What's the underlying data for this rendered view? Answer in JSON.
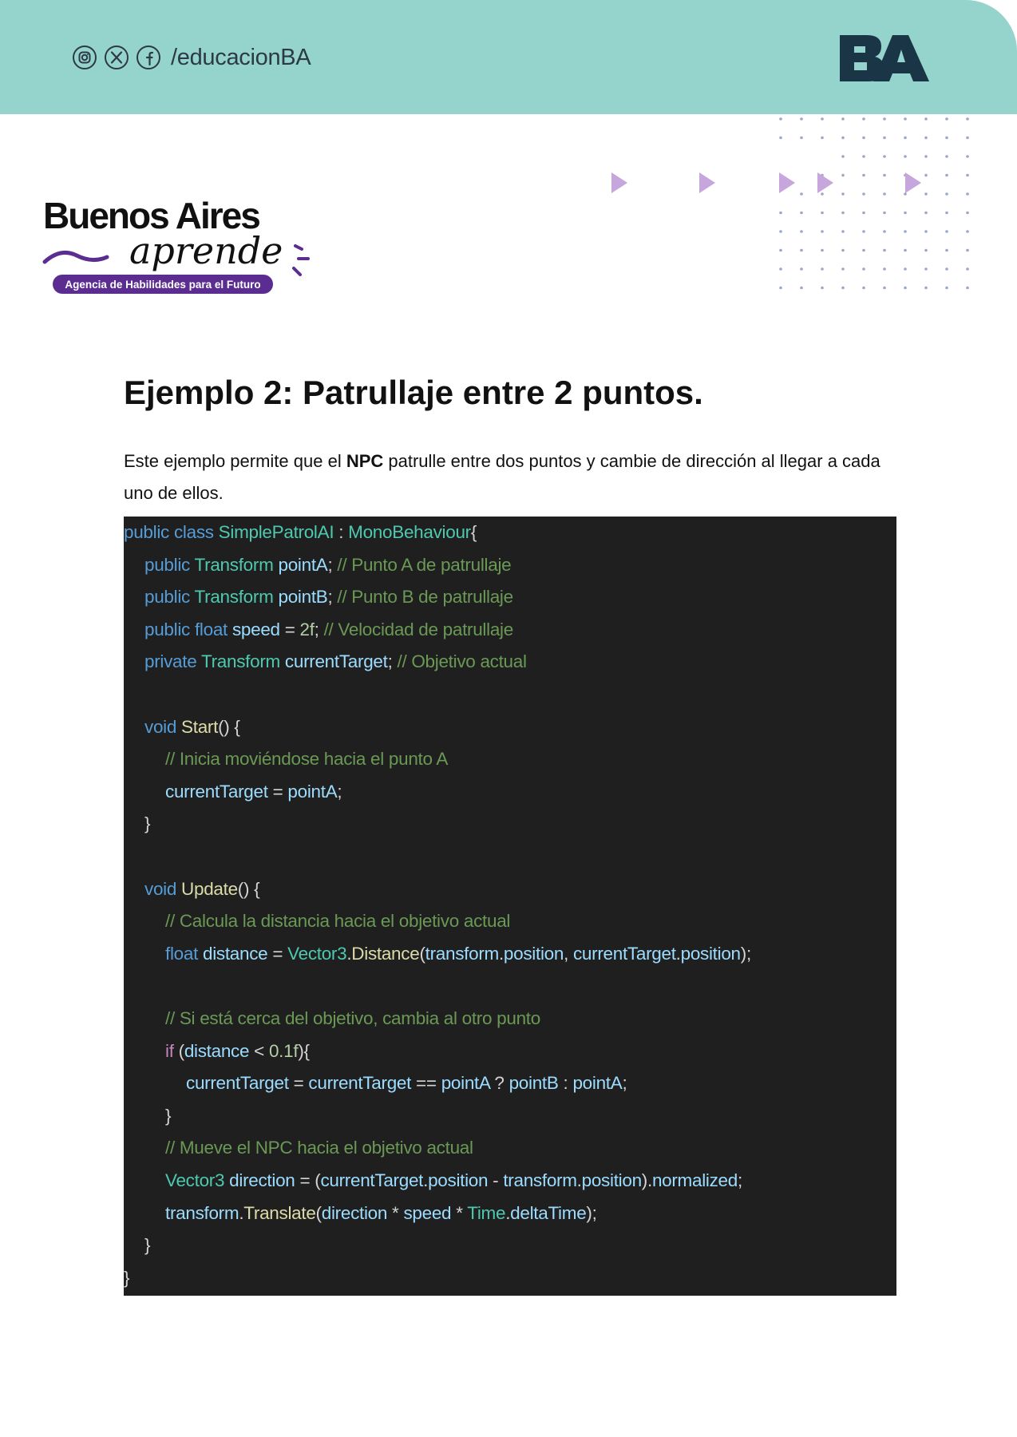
{
  "header": {
    "social_handle": "/educacionBA",
    "icons": [
      "instagram-icon",
      "x-icon",
      "facebook-icon"
    ],
    "logo_text": "BA",
    "band_color": "#95d3cd"
  },
  "brand": {
    "line1": "Buenos Aires",
    "line2": "aprende",
    "tagline": "Agencia de Habilidades para el Futuro",
    "accent_color": "#5b2d91"
  },
  "doc": {
    "title": "Ejemplo 2: Patrullaje entre 2 puntos.",
    "intro_before": "Este ejemplo permite que el ",
    "intro_bold": "NPC",
    "intro_after": " patrulle entre dos puntos y cambie de dirección al llegar a cada uno de ellos."
  },
  "code": {
    "lines": [
      {
        "indent": 0,
        "tokens": [
          [
            "kw",
            "public "
          ],
          [
            "kw",
            "class "
          ],
          [
            "ty",
            "SimplePatrolAI"
          ],
          [
            "pl",
            " : "
          ],
          [
            "ty",
            "MonoBehaviour"
          ],
          [
            "pl",
            "{"
          ]
        ]
      },
      {
        "indent": 1,
        "tokens": [
          [
            "kw",
            "public "
          ],
          [
            "ty",
            "Transform "
          ],
          [
            "id",
            "pointA"
          ],
          [
            "pl",
            "; "
          ],
          [
            "cm",
            "// Punto A de patrullaje"
          ]
        ]
      },
      {
        "indent": 1,
        "tokens": [
          [
            "kw",
            "public "
          ],
          [
            "ty",
            "Transform "
          ],
          [
            "id",
            "pointB"
          ],
          [
            "pl",
            "; "
          ],
          [
            "cm",
            "// Punto B de patrullaje"
          ]
        ]
      },
      {
        "indent": 1,
        "tokens": [
          [
            "kw",
            "public "
          ],
          [
            "kw",
            "float "
          ],
          [
            "id",
            "speed"
          ],
          [
            "pl",
            " = "
          ],
          [
            "num",
            "2f"
          ],
          [
            "pl",
            "; "
          ],
          [
            "cm",
            "// Velocidad de patrullaje"
          ]
        ]
      },
      {
        "indent": 1,
        "tokens": [
          [
            "kw",
            "private "
          ],
          [
            "ty",
            "Transform "
          ],
          [
            "id",
            "currentTarget"
          ],
          [
            "pl",
            "; "
          ],
          [
            "cm",
            "// Objetivo actual"
          ]
        ]
      },
      {
        "indent": 0,
        "tokens": []
      },
      {
        "indent": 1,
        "tokens": [
          [
            "kw",
            "void "
          ],
          [
            "fn",
            "Start"
          ],
          [
            "pl",
            "() {"
          ]
        ]
      },
      {
        "indent": 2,
        "tokens": [
          [
            "cm",
            "// Inicia moviéndose hacia el punto A"
          ]
        ]
      },
      {
        "indent": 2,
        "tokens": [
          [
            "id",
            "currentTarget"
          ],
          [
            "pl",
            " = "
          ],
          [
            "id",
            "pointA"
          ],
          [
            "pl",
            ";"
          ]
        ]
      },
      {
        "indent": 1,
        "tokens": [
          [
            "pl",
            "}"
          ]
        ]
      },
      {
        "indent": 0,
        "tokens": []
      },
      {
        "indent": 1,
        "tokens": [
          [
            "kw",
            "void "
          ],
          [
            "fn",
            "Update"
          ],
          [
            "pl",
            "() {"
          ]
        ]
      },
      {
        "indent": 2,
        "tokens": [
          [
            "cm",
            "// Calcula la distancia hacia el objetivo actual"
          ]
        ]
      },
      {
        "indent": 2,
        "tokens": [
          [
            "kw",
            "float "
          ],
          [
            "id",
            "distance"
          ],
          [
            "pl",
            " = "
          ],
          [
            "ty",
            "Vector3"
          ],
          [
            "pl",
            "."
          ],
          [
            "fn",
            "Distance"
          ],
          [
            "pl",
            "("
          ],
          [
            "id",
            "transform"
          ],
          [
            "pl",
            "."
          ],
          [
            "id",
            "position"
          ],
          [
            "pl",
            ", "
          ],
          [
            "id",
            "currentTarget"
          ],
          [
            "pl",
            "."
          ],
          [
            "id",
            "position"
          ],
          [
            "pl",
            ");"
          ]
        ]
      },
      {
        "indent": 0,
        "tokens": []
      },
      {
        "indent": 2,
        "tokens": [
          [
            "cm",
            "// Si está cerca del objetivo, cambia al otro punto"
          ]
        ]
      },
      {
        "indent": 2,
        "tokens": [
          [
            "ctl",
            "if "
          ],
          [
            "pl",
            "("
          ],
          [
            "id",
            "distance"
          ],
          [
            "pl",
            " < "
          ],
          [
            "num",
            "0.1f"
          ],
          [
            "pl",
            "){"
          ]
        ]
      },
      {
        "indent": 3,
        "tokens": [
          [
            "id",
            "currentTarget"
          ],
          [
            "pl",
            " = "
          ],
          [
            "id",
            "currentTarget"
          ],
          [
            "pl",
            " == "
          ],
          [
            "id",
            "pointA"
          ],
          [
            "pl",
            " ? "
          ],
          [
            "id",
            "pointB"
          ],
          [
            "pl",
            " : "
          ],
          [
            "id",
            "pointA"
          ],
          [
            "pl",
            ";"
          ]
        ]
      },
      {
        "indent": 2,
        "tokens": [
          [
            "pl",
            "}"
          ]
        ]
      },
      {
        "indent": 2,
        "tokens": [
          [
            "cm",
            "// Mueve el NPC hacia el objetivo actual"
          ]
        ]
      },
      {
        "indent": 2,
        "tokens": [
          [
            "ty",
            "Vector3 "
          ],
          [
            "id",
            "direction"
          ],
          [
            "pl",
            " = ("
          ],
          [
            "id",
            "currentTarget"
          ],
          [
            "pl",
            "."
          ],
          [
            "id",
            "position"
          ],
          [
            "pl",
            " - "
          ],
          [
            "id",
            "transform"
          ],
          [
            "pl",
            "."
          ],
          [
            "id",
            "position"
          ],
          [
            "pl",
            ")."
          ],
          [
            "id",
            "normalized"
          ],
          [
            "pl",
            ";"
          ]
        ]
      },
      {
        "indent": 2,
        "tokens": [
          [
            "id",
            "transform"
          ],
          [
            "pl",
            "."
          ],
          [
            "fn",
            "Translate"
          ],
          [
            "pl",
            "("
          ],
          [
            "id",
            "direction"
          ],
          [
            "pl",
            " * "
          ],
          [
            "id",
            "speed"
          ],
          [
            "pl",
            " * "
          ],
          [
            "ty",
            "Time"
          ],
          [
            "pl",
            "."
          ],
          [
            "id",
            "deltaTime"
          ],
          [
            "pl",
            ");"
          ]
        ]
      },
      {
        "indent": 1,
        "tokens": [
          [
            "pl",
            "}"
          ]
        ]
      },
      {
        "indent": 0,
        "tokens": [
          [
            "pl",
            "}"
          ]
        ]
      }
    ]
  }
}
